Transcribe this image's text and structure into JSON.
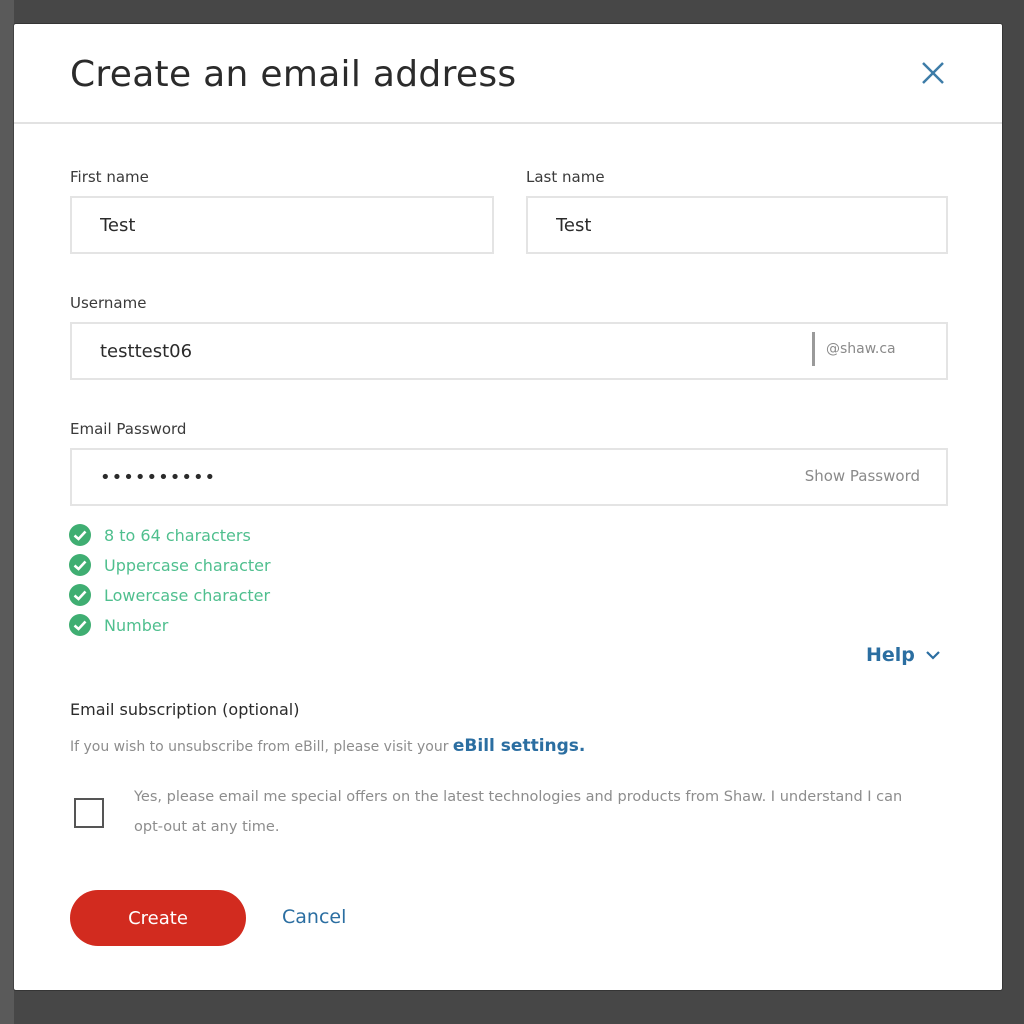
{
  "modal": {
    "title": "Create an email address",
    "close_icon": "close-icon"
  },
  "form": {
    "first_name": {
      "label": "First name",
      "value": "Test"
    },
    "last_name": {
      "label": "Last name",
      "value": "Test"
    },
    "username": {
      "label": "Username",
      "value": "testtest06",
      "suffix": "@shaw.ca"
    },
    "password": {
      "label": "Email Password",
      "value": "••••••••••",
      "show_label": "Show Password"
    }
  },
  "password_rules": [
    {
      "text": "8 to 64 characters",
      "icon": "check-circle-icon"
    },
    {
      "text": "Uppercase character",
      "icon": "check-circle-icon"
    },
    {
      "text": "Lowercase character",
      "icon": "check-circle-icon"
    },
    {
      "text": "Number",
      "icon": "check-circle-icon"
    }
  ],
  "help": {
    "label": "Help",
    "icon": "chevron-down-icon"
  },
  "subscription": {
    "title": "Email subscription (optional)",
    "note": "If you wish to unsubscribe from eBill, please visit your",
    "link": "eBill settings.",
    "offer_text": "Yes, please email me special offers on the latest technologies and products from Shaw. I understand I can opt-out at any time.",
    "checked": false
  },
  "actions": {
    "create": "Create",
    "cancel": "Cancel"
  },
  "colors": {
    "accent_red": "#d22b1f",
    "link_blue": "#2b6ea1",
    "success_green": "#4fbf8e",
    "backdrop": "#474747"
  }
}
